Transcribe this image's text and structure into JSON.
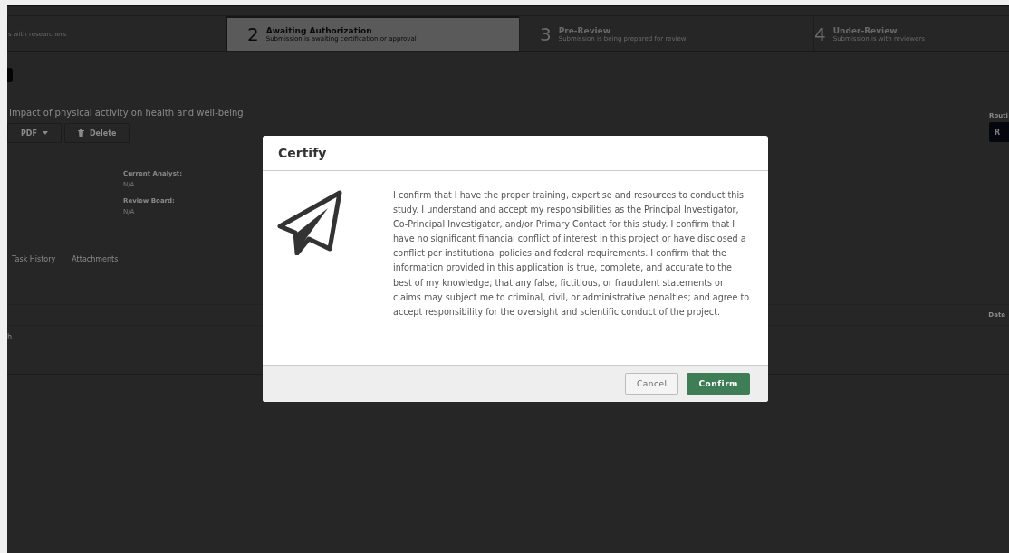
{
  "stepper": [
    {
      "subtitle": "s with researchers",
      "selected": false
    },
    {
      "number": "2",
      "title": "Awaiting Authorization",
      "subtitle": "Submission is awaiting certification or approval",
      "selected": true
    },
    {
      "number": "3",
      "title": "Pre-Review",
      "subtitle": "Submission is being prepared for review",
      "selected": false
    },
    {
      "number": "4",
      "title": "Under-Review",
      "subtitle": "Submission is with reviewers",
      "selected": false
    }
  ],
  "project": {
    "title": "Impact of physical activity on health and well-being",
    "buttons": [
      {
        "kind": "dropdown",
        "label": "PDF"
      },
      {
        "kind": "delete",
        "label": "Delete"
      }
    ],
    "routing_label": "Routi",
    "routing_button": "R"
  },
  "fields": [
    {
      "label": "Current Analyst:",
      "value": "N/A"
    },
    {
      "label": "Review Board:",
      "value": "N/A"
    }
  ],
  "tabs": [
    {
      "label": "Task History",
      "selected": false
    },
    {
      "label": "Attachments",
      "selected": false
    }
  ],
  "table": {
    "date_header": "Date",
    "rows": [
      {
        "cell": "h"
      }
    ]
  },
  "dialog": {
    "title": "Certify",
    "text": "I confirm that I have the proper training, expertise and resources to conduct this study. I understand and accept my responsibilities as the Principal Investigator, Co-Principal Investigator,  and/or Primary Contact for this study. I confirm that I have no significant financial conflict of interest in this project or have disclosed a conflict per institutional policies and federal requirements. I confirm that the information provided in this application is true, complete, and accurate to the best of my knowledge; that any false, fictitious, or fraudulent statements or claims may subject me to criminal, civil, or administrative penalties; and agree to accept responsibility for the oversight and scientific conduct of the project.",
    "buttons": [
      {
        "kind": "secondary",
        "label": "Cancel"
      },
      {
        "kind": "primary",
        "label": "Confirm"
      }
    ]
  }
}
